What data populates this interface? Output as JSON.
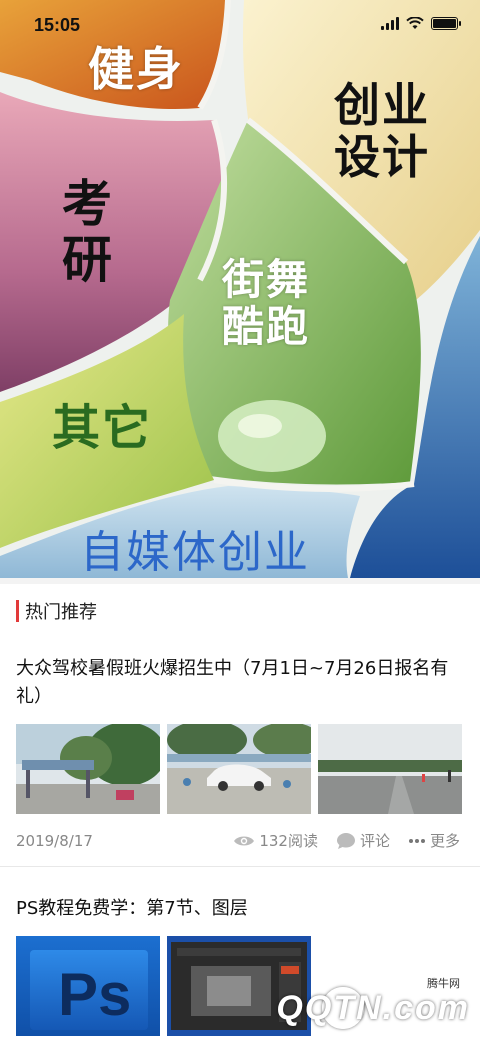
{
  "status_bar": {
    "time": "15:05"
  },
  "categories": {
    "fitness": "健身",
    "startup_design": [
      "创业",
      "设计"
    ],
    "exam": [
      "考",
      "研"
    ],
    "dance": [
      "街舞",
      "酷跑"
    ],
    "other": "其它",
    "media": "自媒体创业"
  },
  "section": {
    "title": "热门推荐"
  },
  "articles": [
    {
      "title": "大众驾校暑假班火爆招生中（7月1日~7月26日报名有礼）",
      "date": "2019/8/17",
      "views": "132阅读",
      "comment_label": "评论",
      "more_label": "更多"
    },
    {
      "title": "PS教程免费学：第7节、图层",
      "thumb_text": "Ps"
    }
  ],
  "watermark": {
    "small": "腾牛网",
    "big": "QQTN.com"
  },
  "colors": {
    "accent": "#e23a3a",
    "media_blue": "#2c67c9",
    "other_green": "#2a6b20"
  },
  "icons": [
    "signal-icon",
    "wifi-icon",
    "battery-icon",
    "eye-icon",
    "comment-icon",
    "more-dots-icon"
  ]
}
